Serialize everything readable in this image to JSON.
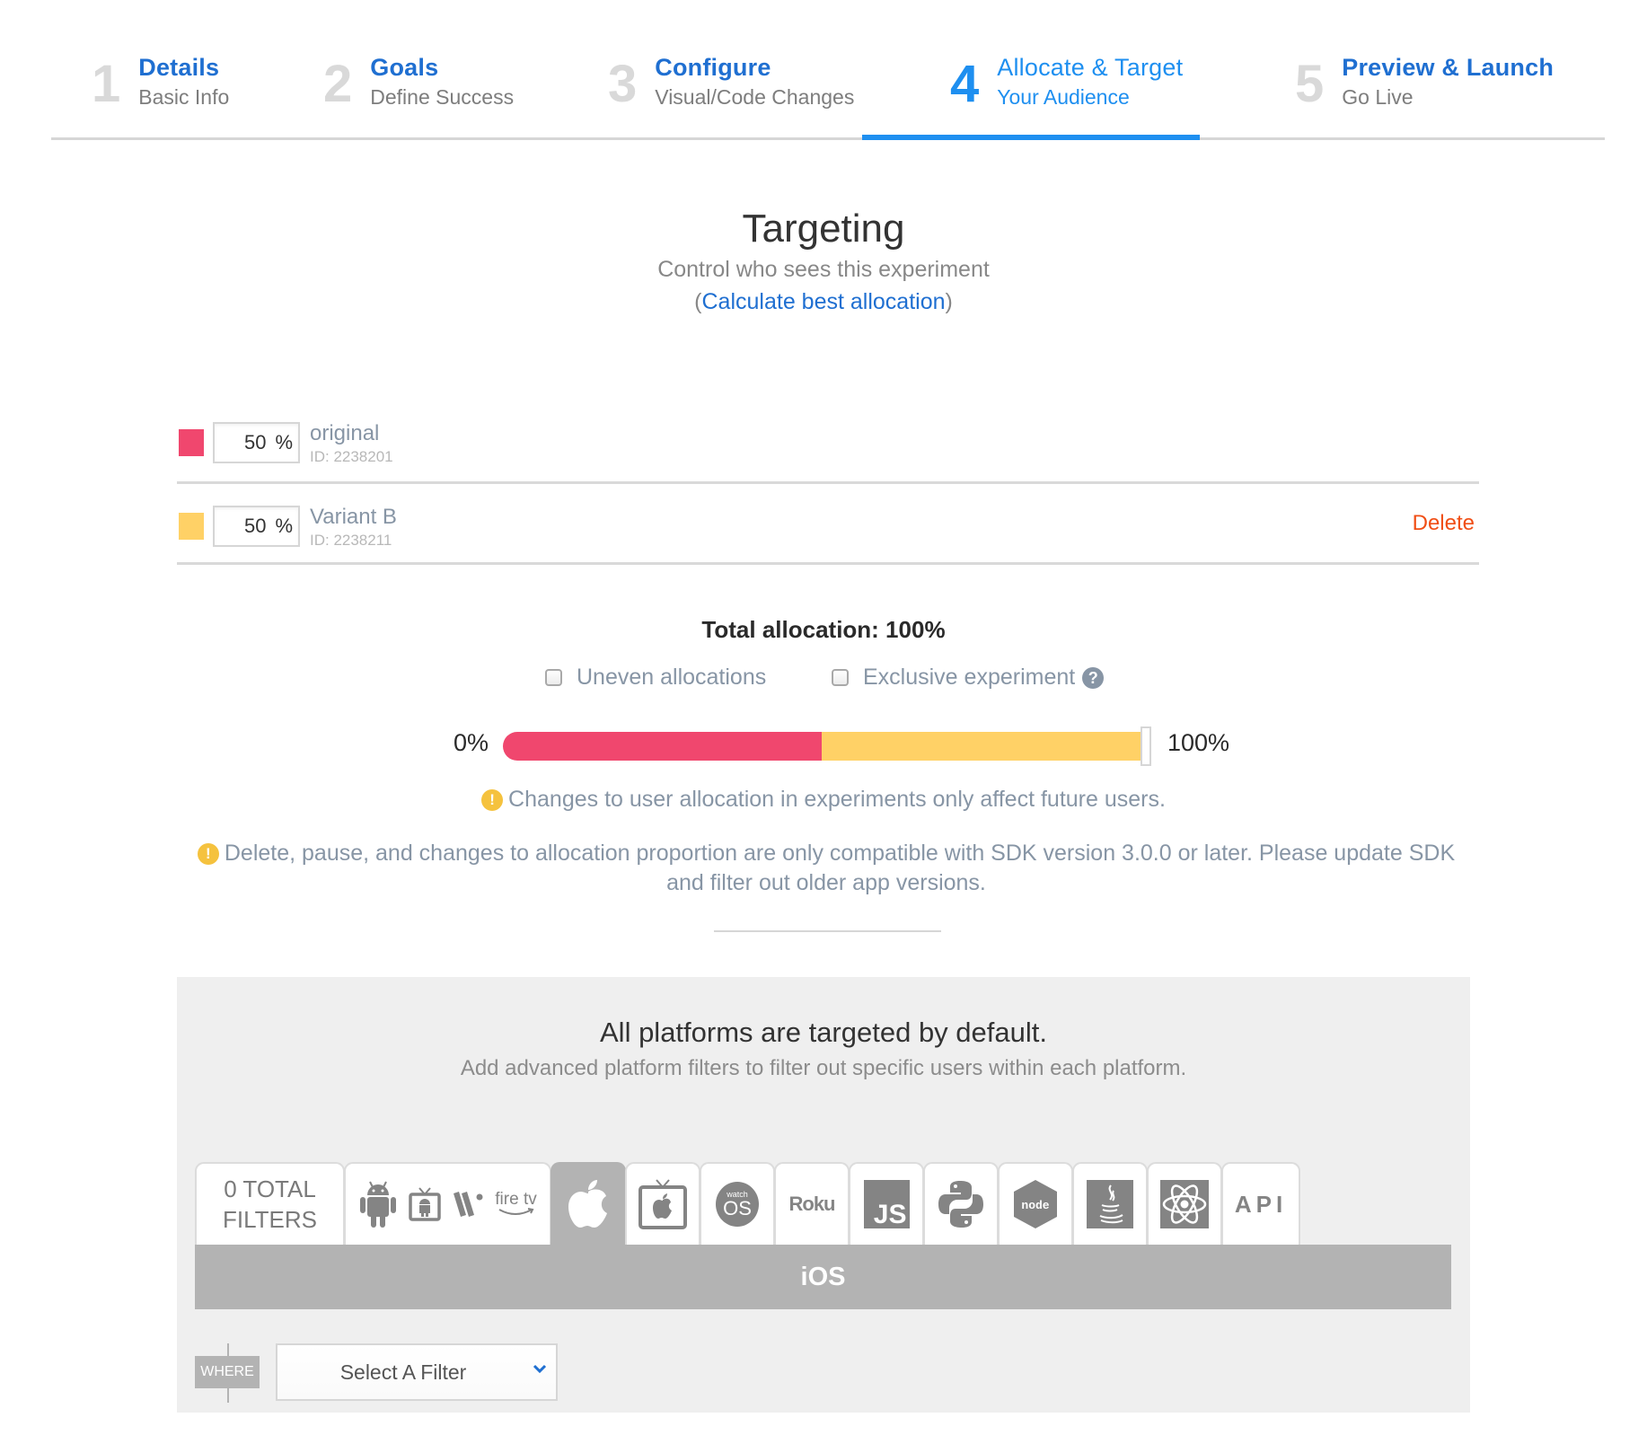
{
  "stepper": {
    "steps": [
      {
        "number": "1",
        "title": "Details",
        "subtitle": "Basic Info",
        "active": false
      },
      {
        "number": "2",
        "title": "Goals",
        "subtitle": "Define Success",
        "active": false
      },
      {
        "number": "3",
        "title": "Configure",
        "subtitle": "Visual/Code Changes",
        "active": false
      },
      {
        "number": "4",
        "title": "Allocate & Target",
        "subtitle": "Your Audience",
        "active": true
      },
      {
        "number": "5",
        "title": "Preview & Launch",
        "subtitle": "Go Live",
        "active": false
      }
    ],
    "active_color": "#1e8ff0"
  },
  "header": {
    "title": "Targeting",
    "subtitle": "Control who sees this experiment",
    "link_open": "(",
    "link_label": "Calculate best allocation",
    "link_close": ")"
  },
  "variants": [
    {
      "name": "original",
      "id_label": "ID: 2238201",
      "percent": "50",
      "unit": "%",
      "color": "#f0476e",
      "delete_label": ""
    },
    {
      "name": "Variant B",
      "id_label": "ID: 2238211",
      "percent": "50",
      "unit": "%",
      "color": "#ffd166",
      "delete_label": "Delete"
    }
  ],
  "allocation": {
    "total_label": "Total allocation: 100%",
    "uneven_label": "Uneven allocations",
    "uneven_checked": false,
    "exclusive_label": "Exclusive experiment",
    "exclusive_checked": false,
    "help_icon": "?",
    "bar_min_label": "0%",
    "bar_max_label": "100%",
    "segments": [
      {
        "variant": "original",
        "percent": 50,
        "color": "#f0476e"
      },
      {
        "variant": "Variant B",
        "percent": 50,
        "color": "#ffd166"
      }
    ]
  },
  "notices": {
    "warning_icon": "!",
    "future_users": "Changes to user allocation in experiments only affect future users.",
    "sdk_version": "Delete, pause, and changes to allocation proportion are only compatible with SDK version 3.0.0 or later. Please update SDK and filter out older app versions."
  },
  "platforms": {
    "title": "All platforms are targeted by default.",
    "subtitle": "Add advanced platform filters to filter out specific users within each platform.",
    "total_filters_line1": "0 TOTAL",
    "total_filters_line2": "FILTERS",
    "tabs": [
      {
        "name": "android",
        "icons": [
          "android-icon",
          "android-tv-icon",
          "wear-os-icon",
          "fire-tv-icon"
        ]
      },
      {
        "name": "ios",
        "icons": [
          "apple-icon"
        ],
        "selected": true
      },
      {
        "name": "tvos",
        "icons": [
          "apple-tv-icon"
        ]
      },
      {
        "name": "watchos",
        "icons": [
          "watchos-icon"
        ],
        "text": "watch OS"
      },
      {
        "name": "roku",
        "icons": [
          "roku-icon"
        ],
        "text": "Roku"
      },
      {
        "name": "javascript",
        "icons": [
          "javascript-icon"
        ],
        "text": "JS"
      },
      {
        "name": "python",
        "icons": [
          "python-icon"
        ]
      },
      {
        "name": "nodejs",
        "icons": [
          "nodejs-icon"
        ],
        "text": "node"
      },
      {
        "name": "java",
        "icons": [
          "java-icon"
        ]
      },
      {
        "name": "react-native",
        "icons": [
          "react-icon"
        ]
      },
      {
        "name": "api",
        "icons": [],
        "text": "API"
      }
    ],
    "fire_tv_text": "fire tv",
    "watch_small": "watch",
    "watch_big": "OS",
    "roku_text": "Roku",
    "js_text": "JS",
    "node_text": "node",
    "api_text": "API",
    "selected_platform": "iOS",
    "where_label": "WHERE",
    "filter_select": "Select A Filter"
  }
}
